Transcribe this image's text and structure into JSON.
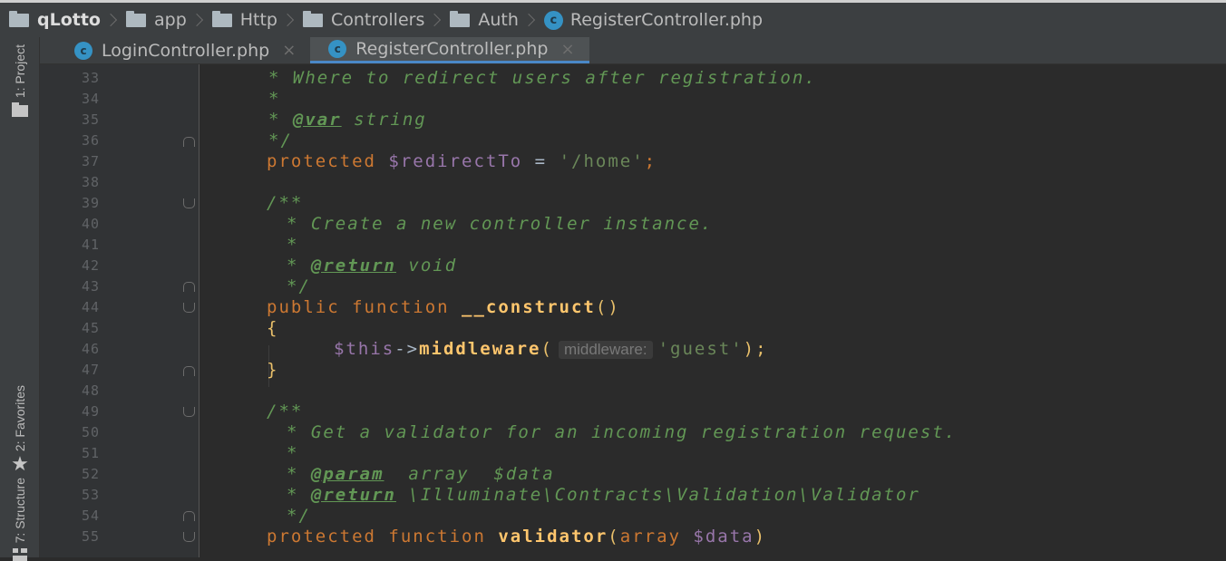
{
  "breadcrumb": [
    {
      "label": "qLotto",
      "type": "folder"
    },
    {
      "label": "app",
      "type": "folder"
    },
    {
      "label": "Http",
      "type": "folder"
    },
    {
      "label": "Controllers",
      "type": "folder"
    },
    {
      "label": "Auth",
      "type": "folder"
    },
    {
      "label": "RegisterController.php",
      "type": "class"
    }
  ],
  "tool_windows": {
    "project": "1: Project",
    "favorites": "2: Favorites",
    "structure": "7: Structure"
  },
  "tabs": [
    {
      "label": "LoginController.php",
      "active": false,
      "icon": "C"
    },
    {
      "label": "RegisterController.php",
      "active": true,
      "icon": "C"
    }
  ],
  "editor": {
    "line_numbers": [
      "33",
      "34",
      "35",
      "36",
      "37",
      "38",
      "39",
      "40",
      "41",
      "42",
      "43",
      "44",
      "45",
      "46",
      "47",
      "48",
      "49",
      "50",
      "51",
      "52",
      "53",
      "54",
      "55"
    ],
    "lines": {
      "l33": "* Where to redirect users after registration.",
      "l34": "*",
      "l35_pre": "* ",
      "l35_tag": "@var",
      "l35_post": " string",
      "l36": "*/",
      "l37_kw": "protected ",
      "l37_var": "$redirectTo",
      "l37_op": " = ",
      "l37_str": "'/home'",
      "l37_end": ";",
      "l39": "/**",
      "l40": "* Create a new controller instance.",
      "l41": "*",
      "l42_pre": "* ",
      "l42_tag": "@return",
      "l42_post": " void",
      "l43": "*/",
      "l44_kw": "public function ",
      "l44_fn": "__construct",
      "l44_end": "()",
      "l45": "{",
      "l46_var": "$this",
      "l46_arrow": "->",
      "l46_fn": "middleware",
      "l46_open": "(",
      "l46_hint": "middleware:",
      "l46_str": "'guest'",
      "l46_end": ");",
      "l47": "}",
      "l49": "/**",
      "l50": "* Get a validator for an incoming registration request.",
      "l51": "*",
      "l52_pre": "* ",
      "l52_tag": "@param",
      "l52_post": "  array  $data",
      "l53_pre": "* ",
      "l53_tag": "@return",
      "l53_post": " \\Illuminate\\Contracts\\Validation\\Validator",
      "l54": "*/",
      "l55_kw": "protected function ",
      "l55_fn": "validator",
      "l55_open": "(",
      "l55_type": "array ",
      "l55_var": "$data",
      "l55_close": ")"
    }
  },
  "colors": {
    "background": "#2b2b2b",
    "keyword": "#cc7832",
    "comment": "#629755",
    "variable": "#9876aa",
    "string": "#6a8759",
    "function": "#ffc66d",
    "active_tab_underline": "#4a88c7"
  }
}
